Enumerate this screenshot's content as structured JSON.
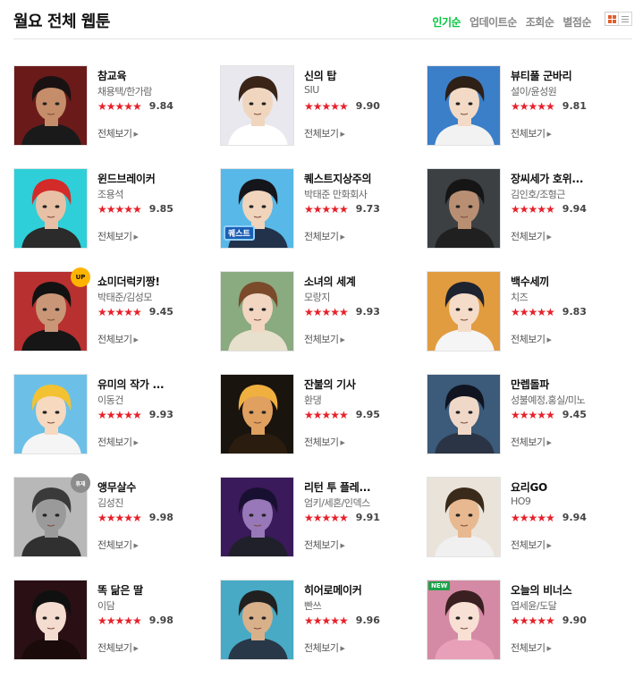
{
  "header": {
    "title": "월요 전체 웹툰",
    "sort_tabs": [
      "인기순",
      "업데이트순",
      "조회순",
      "별점순"
    ],
    "active_sort": "인기순",
    "view_modes": [
      "grid-view-icon",
      "list-view-icon"
    ]
  },
  "common": {
    "stars": "★★★★★",
    "more_label": "전체보기",
    "more_arrow": "▶"
  },
  "colors": {
    "accent_green": "#00c73c",
    "star_red": "#e6212a"
  },
  "items": [
    {
      "title": "참교육",
      "author": "채용택/한가람",
      "score": "9.84"
    },
    {
      "title": "신의 탑",
      "author": "SIU",
      "score": "9.90"
    },
    {
      "title": "뷰티풀 군바리",
      "author": "설이/윤성원",
      "score": "9.81"
    },
    {
      "title": "윈드브레이커",
      "author": "조용석",
      "score": "9.85"
    },
    {
      "title": "퀘스트지상주의",
      "author": "박태준 만화회사",
      "score": "9.73",
      "logo_text": "퀘스트"
    },
    {
      "title": "장씨세가 호위...",
      "author": "김인호/조형근",
      "score": "9.94"
    },
    {
      "title": "쇼미더럭키짱!",
      "author": "박태준/김성모",
      "score": "9.45",
      "badge": "UP"
    },
    {
      "title": "소녀의 세계",
      "author": "모랑지",
      "score": "9.93"
    },
    {
      "title": "백수세끼",
      "author": "치즈",
      "score": "9.83"
    },
    {
      "title": "유미의 작가 ...",
      "author": "이동건",
      "score": "9.93"
    },
    {
      "title": "잔불의 기사",
      "author": "환댕",
      "score": "9.95"
    },
    {
      "title": "만렙돌파",
      "author": "성불예정,홍실/미노",
      "score": "9.45"
    },
    {
      "title": "앵무살수",
      "author": "김성진",
      "score": "9.98",
      "badge": "휴재"
    },
    {
      "title": "리턴 투 플레...",
      "author": "엄키/세혼/인덱스",
      "score": "9.91"
    },
    {
      "title": "요리GO",
      "author": "HO9",
      "score": "9.94"
    },
    {
      "title": "똑 닮은 딸",
      "author": "이담",
      "score": "9.98"
    },
    {
      "title": "히어로메이커",
      "author": "빤쓰",
      "score": "9.96"
    },
    {
      "title": "오늘의 비너스",
      "author": "엽세윤/도달",
      "score": "9.90",
      "badge": "NEW"
    }
  ],
  "thumb_colors": [
    {
      "bg": "#6b1a1a",
      "hair": "#1a1212",
      "skin": "#c58d6a",
      "shirt": "#1a1a1a"
    },
    {
      "bg": "#e8e8ee",
      "hair": "#3a2418",
      "skin": "#f1d6bf",
      "shirt": "#ffffff"
    },
    {
      "bg": "#3b7fc8",
      "hair": "#2e1f17",
      "skin": "#f3dac6",
      "shirt": "#f2f2f2"
    },
    {
      "bg": "#2ecfd8",
      "hair": "#d32a2a",
      "skin": "#e8c0a5",
      "shirt": "#2b2b2b"
    },
    {
      "bg": "#58b8e8",
      "hair": "#15151c",
      "skin": "#f0d4bc",
      "shirt": "#22324a"
    },
    {
      "bg": "#3c4043",
      "hair": "#151515",
      "skin": "#b88f73",
      "shirt": "#202020"
    },
    {
      "bg": "#b83030",
      "hair": "#121212",
      "skin": "#c99777",
      "shirt": "#161616"
    },
    {
      "bg": "#8aaa80",
      "hair": "#7a4a2a",
      "skin": "#f2d6c2",
      "shirt": "#e6e0cc"
    },
    {
      "bg": "#e29c40",
      "hair": "#1e2330",
      "skin": "#f5dcc8",
      "shirt": "#f5f5f5"
    },
    {
      "bg": "#6cc0e8",
      "hair": "#f2c232",
      "skin": "#f7d9c0",
      "shirt": "#f5f5f5"
    },
    {
      "bg": "#1a140e",
      "hair": "#f0b040",
      "skin": "#e0a060",
      "shirt": "#2a1d10"
    },
    {
      "bg": "#3c5a7a",
      "hair": "#101420",
      "skin": "#f0d8c8",
      "shirt": "#2a3444"
    },
    {
      "bg": "#b8b8b8",
      "hair": "#3a3a3a",
      "skin": "#9a9a9a",
      "shirt": "#303030"
    },
    {
      "bg": "#3a1a5a",
      "hair": "#181030",
      "skin": "#9878b8",
      "shirt": "#20202a"
    },
    {
      "bg": "#e9e3da",
      "hair": "#3a2a1a",
      "skin": "#e8b890",
      "shirt": "#f0f0f0"
    },
    {
      "bg": "#2a1015",
      "hair": "#101010",
      "skin": "#f4dcd0",
      "shirt": "#1a0a0a"
    },
    {
      "bg": "#48aac4",
      "hair": "#202020",
      "skin": "#d8b08a",
      "shirt": "#283848"
    },
    {
      "bg": "#d48aa4",
      "hair": "#3a2020",
      "skin": "#f8e0d4",
      "shirt": "#e8a0b8"
    }
  ]
}
